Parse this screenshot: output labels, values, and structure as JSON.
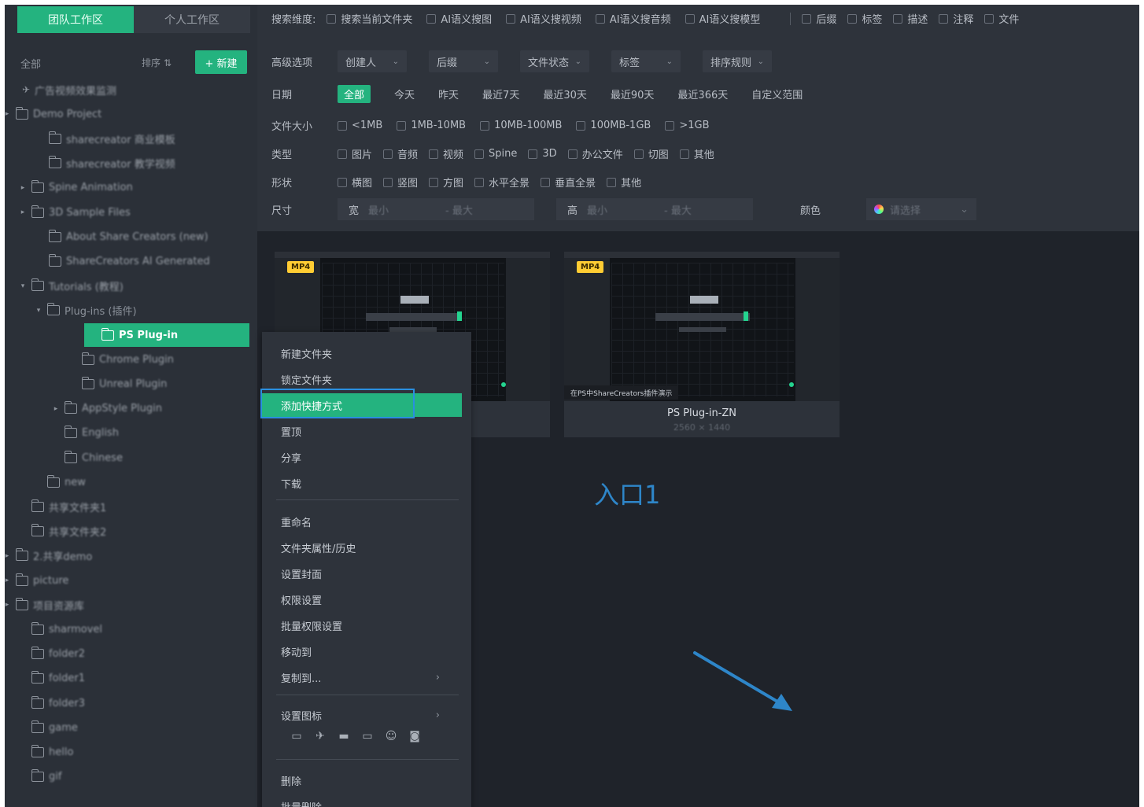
{
  "workspace_tabs": {
    "team": "团队工作区",
    "personal": "个人工作区"
  },
  "sidebar_top": {
    "all_label": "全部",
    "sort_label": "排序",
    "new_label": "+ 新建"
  },
  "tree": [
    {
      "label": "广告视频效果监测",
      "blurred": true
    },
    {
      "label": "Demo Project",
      "blurred": true
    },
    {
      "label": "sharecreator 商业模板",
      "blurred": true
    },
    {
      "label": "sharecreator 教学视频",
      "blurred": true
    },
    {
      "label": "Spine Animation",
      "blurred": true
    },
    {
      "label": "3D Sample Files",
      "blurred": true
    },
    {
      "label": "About Share Creators (new)",
      "blurred": true
    },
    {
      "label": "ShareCreators AI Generated",
      "blurred": true
    },
    {
      "label": "Tutorials (教程)",
      "blurred": true
    },
    {
      "label": "Plug-ins (插件)",
      "blurred": false
    },
    {
      "label": "PS Plug-in",
      "blurred": false,
      "selected": true
    },
    {
      "label": "Chrome Plugin",
      "blurred": true
    },
    {
      "label": "Unreal Plugin",
      "blurred": true
    },
    {
      "label": "AppStyle Plugin",
      "blurred": true
    },
    {
      "label": "English",
      "blurred": true
    },
    {
      "label": "Chinese",
      "blurred": true
    },
    {
      "label": "new",
      "blurred": true
    },
    {
      "label": "共享文件夹1",
      "blurred": true
    },
    {
      "label": "共享文件夹2",
      "blurred": true
    },
    {
      "label": "2.共享demo",
      "blurred": true
    },
    {
      "label": "picture",
      "blurred": true
    },
    {
      "label": "项目资源库",
      "blurred": true
    },
    {
      "label": "sharmovel",
      "blurred": true
    },
    {
      "label": "folder2",
      "blurred": true
    },
    {
      "label": "folder1",
      "blurred": true
    },
    {
      "label": "folder3",
      "blurred": true
    },
    {
      "label": "game",
      "blurred": true
    },
    {
      "label": "hello",
      "blurred": true
    },
    {
      "label": "gif",
      "blurred": true
    }
  ],
  "search_scope": {
    "label": "搜索维度:",
    "options": [
      "搜索当前文件夹",
      "AI语义搜图",
      "AI语义搜视频",
      "AI语义搜音频",
      "AI语义搜模型"
    ],
    "extra": [
      "后缀",
      "标签",
      "描述",
      "注释",
      "文件"
    ]
  },
  "advanced": {
    "label": "高级选项",
    "dropdowns": [
      "创建人",
      "后缀",
      "文件状态",
      "标签",
      "排序规则"
    ]
  },
  "date": {
    "label": "日期",
    "options": [
      "全部",
      "今天",
      "昨天",
      "最近7天",
      "最近30天",
      "最近90天",
      "最近366天",
      "自定义范围"
    ]
  },
  "file_size": {
    "label": "文件大小",
    "options": [
      "<1MB",
      "1MB-10MB",
      "10MB-100MB",
      "100MB-1GB",
      ">1GB"
    ]
  },
  "type": {
    "label": "类型",
    "options": [
      "图片",
      "音频",
      "视频",
      "Spine",
      "3D",
      "办公文件",
      "切图",
      "其他"
    ]
  },
  "shape": {
    "label": "形状",
    "options": [
      "横图",
      "竖图",
      "方图",
      "水平全景",
      "垂直全景",
      "其他"
    ]
  },
  "size": {
    "label": "尺寸",
    "width_label": "宽",
    "height_label": "高",
    "min_ph": "最小",
    "max_ph": "- 最大",
    "color_label": "颜色",
    "color_ph": "请选择"
  },
  "cards": [
    {
      "badge": "MP4",
      "title": "",
      "dims": ""
    },
    {
      "badge": "MP4",
      "caption": "在PS中ShareCreators插件演示",
      "title": "PS Plug-in-ZN",
      "dims": "2560 × 1440"
    }
  ],
  "context_menu": {
    "items": [
      "新建文件夹",
      "锁定文件夹",
      "添加快捷方式",
      "置顶",
      "分享",
      "下载",
      "重命名",
      "文件夹属性/历史",
      "设置封面",
      "权限设置",
      "批量权限设置",
      "移动到",
      "复制到...",
      "设置图标",
      "删除",
      "批量删除"
    ],
    "submenu_arrow": "›"
  },
  "annotation": "入口1",
  "colors": {
    "accent": "#24b37f",
    "highlight_outline": "#2a8fe0",
    "annotation": "#2e86c9"
  }
}
